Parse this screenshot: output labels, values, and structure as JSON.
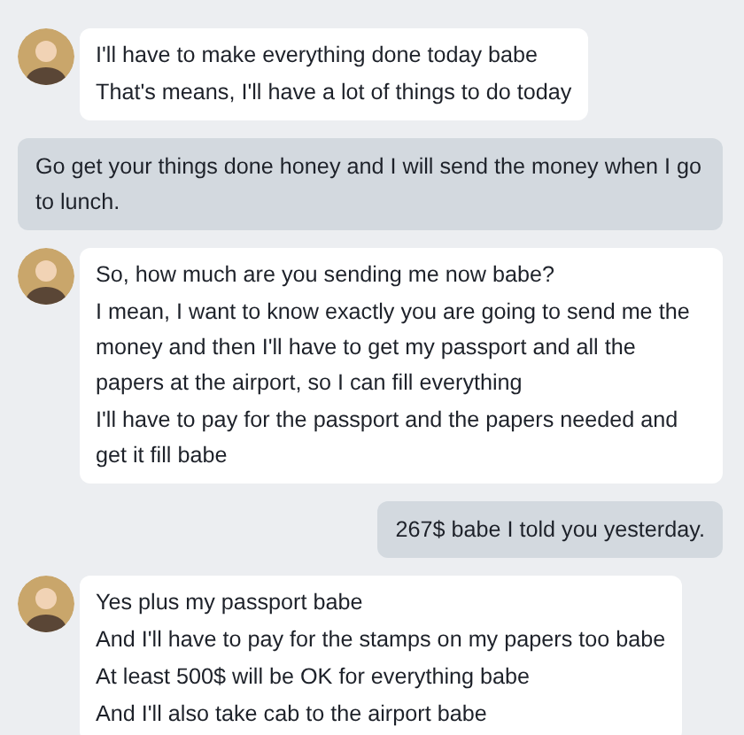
{
  "messages": [
    {
      "kind": "incoming",
      "lines": [
        "I'll have to make everything done today babe",
        "That's means, I'll have a lot of things to do today"
      ]
    },
    {
      "kind": "outgoing",
      "lines": [
        "Go get your things done honey and I will send the money when I go to lunch."
      ]
    },
    {
      "kind": "incoming",
      "lines": [
        "So, how much are you sending me now babe?",
        "I mean, I want to know exactly you are going to send me the money and then I'll have to get my passport and all the papers at the airport, so I can fill everything",
        "I'll have to pay for the passport and the papers needed and get it fill babe"
      ]
    },
    {
      "kind": "outgoing",
      "lines": [
        "267$ babe I told you yesterday."
      ]
    },
    {
      "kind": "incoming",
      "lines": [
        "Yes plus my passport babe",
        "And I'll have to pay for the stamps on my papers too babe",
        "At least 500$ will be OK for everything babe",
        "And I'll also take cab to the airport babe"
      ]
    }
  ]
}
